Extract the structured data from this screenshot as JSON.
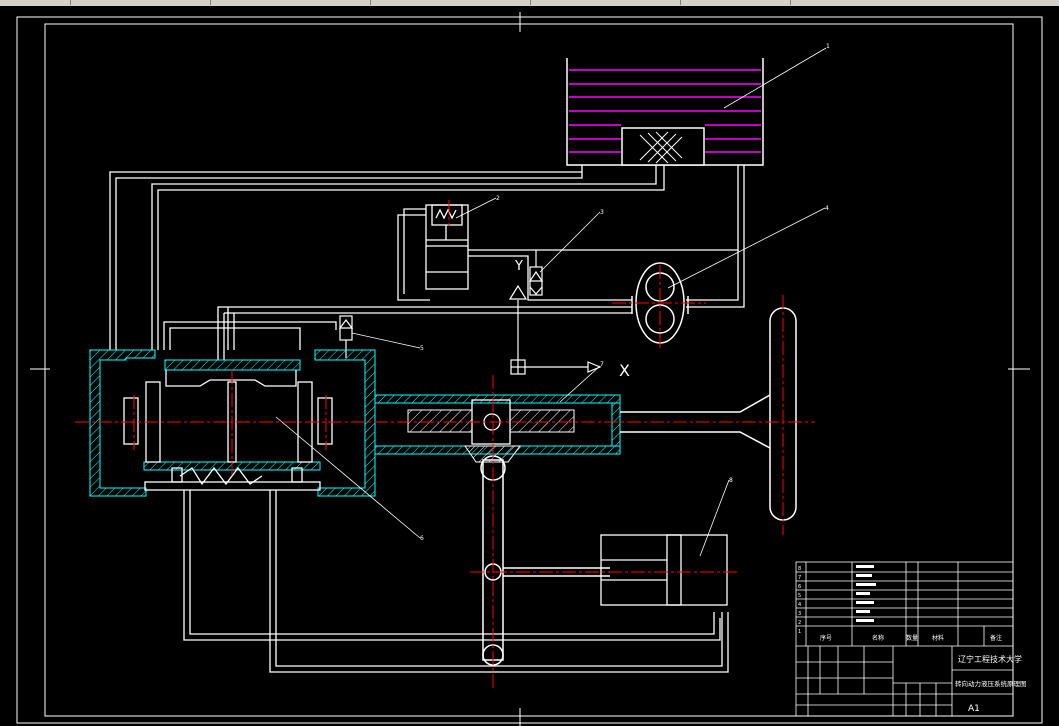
{
  "drawing": {
    "callouts": [
      "1",
      "2",
      "3",
      "4",
      "5",
      "6",
      "7",
      "8"
    ],
    "symbols": [
      "Y",
      "X"
    ]
  },
  "title_block": {
    "school": "辽宁工程技术大学",
    "drawing_title": "转向动力液压系统原理图",
    "sheet_size": "A1",
    "headers": [
      "序号",
      "名称",
      "数量",
      "材料",
      "备注"
    ],
    "item_numbers": [
      "8",
      "7",
      "6",
      "5",
      "4",
      "3",
      "2",
      "1"
    ]
  },
  "colors": {
    "background": "#000000",
    "lines": "#ffffff",
    "centerline": "#ff0000",
    "tank_fluid": "#ff00ff",
    "section_hatch": "#00ffff",
    "toolbar": "#d4d0c8"
  }
}
